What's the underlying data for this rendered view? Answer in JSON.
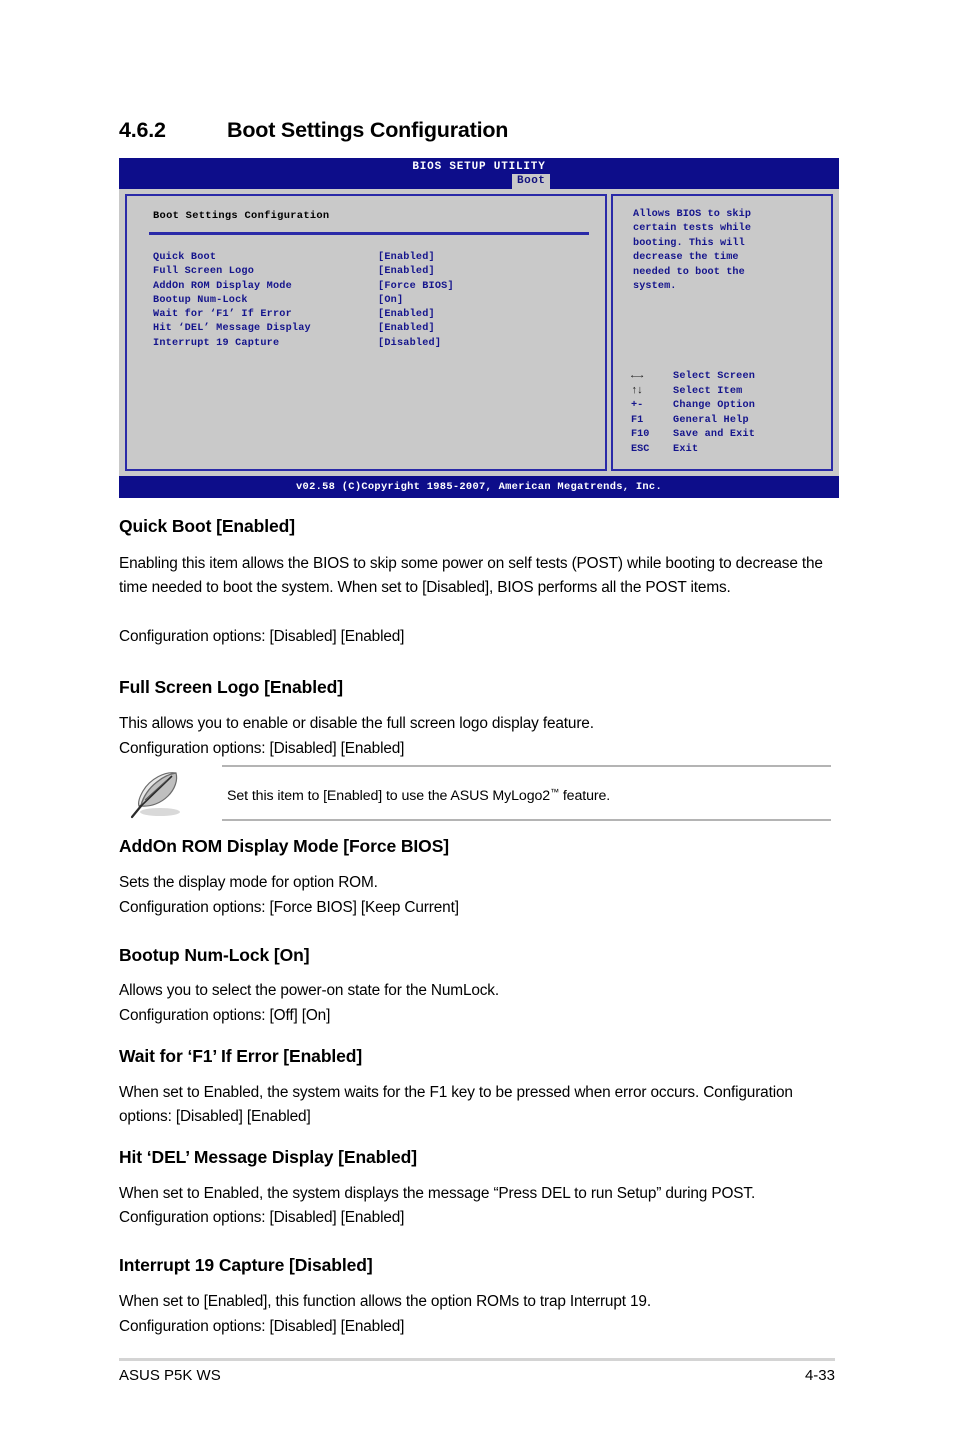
{
  "section": {
    "number": "4.6.2",
    "title": "Boot Settings Configuration"
  },
  "bios": {
    "title": "BIOS SETUP UTILITY",
    "tab": "Boot",
    "config_title": "Boot Settings Configuration",
    "items": [
      {
        "label": "Quick Boot",
        "value": "[Enabled]"
      },
      {
        "label": "Full Screen Logo",
        "value": "[Enabled]"
      },
      {
        "label": "AddOn ROM Display Mode",
        "value": "[Force BIOS]"
      },
      {
        "label": "Bootup Num-Lock",
        "value": "[On]"
      },
      {
        "label": "Wait for ‘F1’ If Error",
        "value": "[Enabled]"
      },
      {
        "label": "Hit ‘DEL’ Message Display",
        "value": "[Enabled]"
      },
      {
        "label": "Interrupt 19 Capture",
        "value": "[Disabled]"
      }
    ],
    "help_lines": [
      "Allows BIOS to skip",
      "certain tests while",
      "booting. This will",
      "decrease the time",
      "needed to boot the",
      "system."
    ],
    "legend": [
      {
        "key": "←→",
        "icon": "left-right-arrow-icon",
        "desc": "Select Screen"
      },
      {
        "key": "↑↓",
        "icon": "up-down-arrow-icon",
        "desc": "Select Item"
      },
      {
        "key": "+-",
        "icon": "plus-minus-key-icon",
        "desc": "Change Option"
      },
      {
        "key": "F1",
        "icon": "f1-key-icon",
        "desc": "General Help"
      },
      {
        "key": "F10",
        "icon": "f10-key-icon",
        "desc": "Save and Exit"
      },
      {
        "key": "ESC",
        "icon": "esc-key-icon",
        "desc": "Exit"
      }
    ],
    "footer": "v02.58 (C)Copyright 1985-2007, American Megatrends, Inc.",
    "colors": {
      "titlebar": "#0d0d8a",
      "body": "#c9c9c9",
      "border": "#2a2aa8",
      "text": "#14148c"
    }
  },
  "sections": {
    "quick_boot": {
      "heading": "Quick Boot [Enabled]",
      "body": "Enabling this item allows the BIOS to skip some power on self tests (POST) while booting to decrease the time needed to boot the system. When set to [Disabled], BIOS performs all the POST items.",
      "options": "Configuration options: [Disabled] [Enabled]"
    },
    "full_screen_logo": {
      "heading": "Full Screen Logo [Enabled]",
      "body": "This allows you to enable or disable the full screen logo display feature.",
      "options": "Configuration options: [Disabled] [Enabled]"
    },
    "note": {
      "icon": "note-quill-icon",
      "text_before": "Set this item to [Enabled] to use the ASUS MyLogo2",
      "trademark": "™",
      "text_after": " feature."
    },
    "addon_rom": {
      "heading": "AddOn ROM Display Mode [Force BIOS]",
      "body": "Sets the display mode for option ROM.",
      "options": "Configuration options: [Force BIOS] [Keep Current]"
    },
    "bootup_numlock": {
      "heading": "Bootup Num-Lock [On]",
      "body": "Allows you to select the power-on state for the NumLock.",
      "options": "Configuration options: [Off] [On]"
    },
    "wait_f1": {
      "heading": "Wait for ‘F1’ If Error [Enabled]",
      "body": "When set to Enabled, the system waits for the F1 key to be pressed when error occurs. Configuration options: [Disabled] [Enabled]"
    },
    "hit_del": {
      "heading": "Hit ‘DEL’ Message Display [Enabled]",
      "body": "When set to Enabled, the system displays the message “Press DEL to run Setup” during POST. Configuration options: [Disabled] [Enabled]"
    },
    "interrupt19": {
      "heading": "Interrupt 19 Capture [Disabled]",
      "body": "When set to [Enabled], this function allows the option ROMs to trap Interrupt 19.",
      "options": "Configuration options: [Disabled] [Enabled]"
    }
  },
  "footer": {
    "left": "ASUS P5K WS",
    "right": "4-33"
  }
}
